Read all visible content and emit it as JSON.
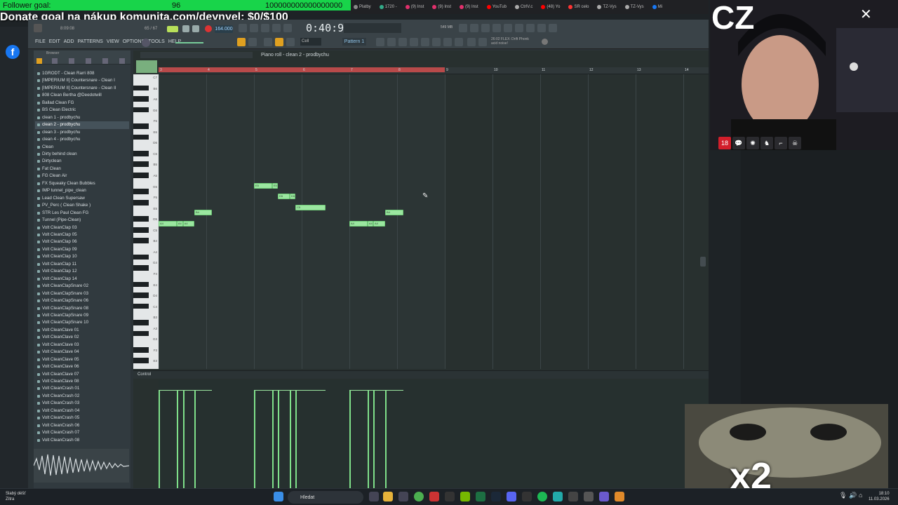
{
  "overlay": {
    "follower_label": "Follower goal:",
    "follower_value": "96",
    "follower_big": "100000000000000000",
    "donate_text": "Donate goal na nákup komunita.com/deynyel: $0/$100"
  },
  "browser_tabs": [
    {
      "label": "Platby",
      "color": "#888"
    },
    {
      "label": "1720 -",
      "color": "#3a8"
    },
    {
      "label": "(9) Inst",
      "color": "#e1306c"
    },
    {
      "label": "(9) Inst",
      "color": "#e1306c"
    },
    {
      "label": "(9) Inst",
      "color": "#e1306c"
    },
    {
      "label": "YouTub",
      "color": "#f00"
    },
    {
      "label": "CtrlV.c",
      "color": "#aaa"
    },
    {
      "label": "(48) Yo",
      "color": "#f00"
    },
    {
      "label": "SR celo",
      "color": "#f33"
    },
    {
      "label": "TZ-Vys",
      "color": "#aaa"
    },
    {
      "label": "TZ-Vys",
      "color": "#aaa"
    },
    {
      "label": "Mi",
      "color": "#1877f2"
    }
  ],
  "fl": {
    "menus": [
      "FILE",
      "EDIT",
      "ADD",
      "PATTERNS",
      "VIEW",
      "OPTIONS",
      "TOOLS",
      "HELP"
    ],
    "time": "0:40:97",
    "bpm": "164.000",
    "pattern": "Pattern 1",
    "snap": "Cell",
    "hint_line1": "26:02  FLEX: Drift Phonk",
    "hint_line2": "acid noise!",
    "mem": "549 MB",
    "song_pos": "8:09:08",
    "cpu": "65 / 67"
  },
  "browser": {
    "label": "Browser",
    "items": [
      "1GRODT - Clean Rarri 808",
      "[IMPERIUM II] Countersnare - Clean I",
      "[IMPERIUM II] Countersnare - Clean II",
      "808 Clean Bertha @Deedotwill",
      "Ballad Clean FG",
      "BS Clean Electric",
      "clean 1 - prodbychu",
      "clean 2 - prodbychu",
      "clean 3 - prodbychu",
      "clean 4 - prodbychu",
      "Clean",
      "Dirty behind clean",
      "Dirtyclean",
      "Fat Clean",
      "FG Clean Air",
      "FX Squeaky Clean Bubbles",
      "IMP tunnel_pipe_clean",
      "Lead Clean Supersaw",
      "PV_Perc ( Clean Shake )",
      "STR Les Paul Clean FG",
      "Tunnel (Pipe-Clean)",
      "Volt CleanClap 03",
      "Volt CleanClap 05",
      "Volt CleanClap 06",
      "Volt CleanClap 09",
      "Volt CleanClap 10",
      "Volt CleanClap 11",
      "Volt CleanClap 12",
      "Volt CleanClap 14",
      "Volt CleanClapSnare 02",
      "Volt CleanClapSnare 03",
      "Volt CleanClapSnare 06",
      "Volt CleanClapSnare 08",
      "Volt CleanClapSnare 09",
      "Volt CleanClapSnare 10",
      "Volt CleanClave 01",
      "Volt CleanClave 02",
      "Volt CleanClave 03",
      "Volt CleanClave 04",
      "Volt CleanClave 05",
      "Volt CleanClave 06",
      "Volt CleanClave 07",
      "Volt CleanClave 08",
      "Volt CleanCrash 01",
      "Volt CleanCrash 02",
      "Volt CleanCrash 03",
      "Volt CleanCrash 04",
      "Volt CleanCrash 05",
      "Volt CleanCrash 06",
      "Volt CleanCrash 07",
      "Volt CleanCrash 08"
    ],
    "selected_index": 7
  },
  "piano_roll": {
    "title": "Piano roll - clean 2 - prodbychu",
    "bar_numbers": [
      "3",
      "4",
      "5",
      "6",
      "7",
      "8",
      "9",
      "10",
      "11",
      "12",
      "13",
      "14"
    ],
    "key_labels": [
      "C7",
      "B6",
      "A6",
      "G6",
      "F6",
      "E6",
      "D6",
      "C6",
      "B5",
      "A5",
      "G5",
      "F5",
      "E5",
      "D5",
      "C5",
      "B4",
      "A4",
      "G4",
      "F4",
      "E4",
      "D4",
      "C4",
      "B3",
      "A3",
      "G3",
      "F3",
      "E3"
    ],
    "control_label": "Control",
    "notes": [
      {
        "pitch": "A4",
        "start": 0.0,
        "length": 0.38,
        "label": "A4"
      },
      {
        "pitch": "A4",
        "start": 0.38,
        "length": 0.13,
        "label": "A4"
      },
      {
        "pitch": "A4",
        "start": 0.51,
        "length": 0.24,
        "label": "A4"
      },
      {
        "pitch": "B4",
        "start": 0.75,
        "length": 0.37,
        "label": "B4"
      },
      {
        "pitch": "E5",
        "start": 2.0,
        "length": 0.38,
        "label": "E5"
      },
      {
        "pitch": "E5",
        "start": 2.38,
        "length": 0.12,
        "label": "E5"
      },
      {
        "pitch": "D5",
        "start": 2.5,
        "length": 0.25,
        "label": "D5"
      },
      {
        "pitch": "D5",
        "start": 2.75,
        "length": 0.12,
        "label": "D5"
      },
      {
        "pitch": "C5",
        "start": 2.87,
        "length": 0.63,
        "label": "C5"
      },
      {
        "pitch": "A4",
        "start": 4.0,
        "length": 0.38,
        "label": "A4"
      },
      {
        "pitch": "A4",
        "start": 4.38,
        "length": 0.12,
        "label": "A4"
      },
      {
        "pitch": "A4",
        "start": 4.5,
        "length": 0.25,
        "label": "A4"
      },
      {
        "pitch": "B4",
        "start": 4.75,
        "length": 0.38,
        "label": "B4"
      }
    ]
  },
  "webcam": {
    "logo_text": "CZ",
    "badge_18": "18",
    "meme_text": "x2"
  },
  "taskbar": {
    "weather_line1": "Slabý déšť",
    "weather_line2": "Zítra",
    "search_placeholder": "Hledat",
    "time": "18:10",
    "date": "11.03.2026"
  }
}
